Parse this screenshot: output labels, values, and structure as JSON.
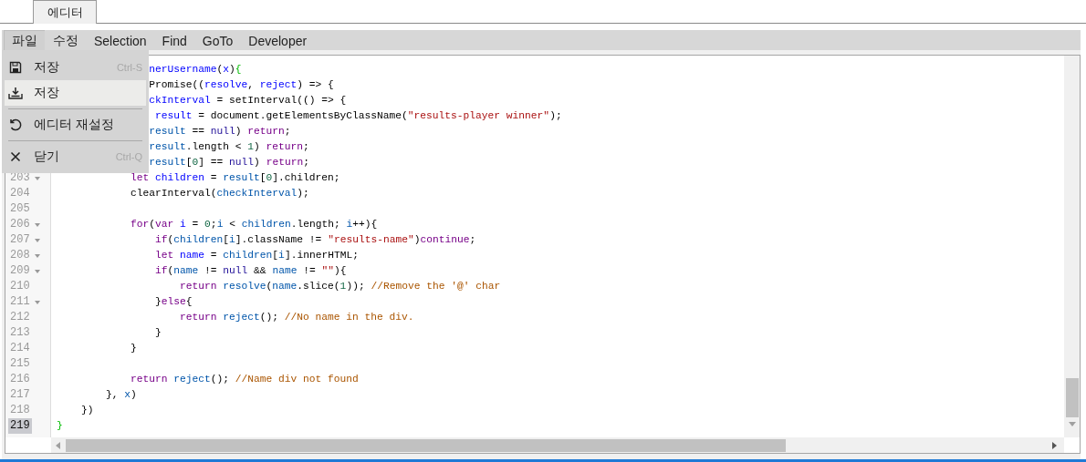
{
  "tabs": [
    {
      "label": "에디터",
      "selected": true
    }
  ],
  "menubar": [
    {
      "label": "파일",
      "selected": true
    },
    {
      "label": "수정",
      "selected": false
    },
    {
      "label": "Selection",
      "selected": false
    },
    {
      "label": "Find",
      "selected": false
    },
    {
      "label": "GoTo",
      "selected": false
    },
    {
      "label": "Developer",
      "selected": false
    }
  ],
  "file_menu": [
    {
      "kind": "save",
      "label": "저장",
      "shortcut": "Ctrl-S",
      "selected": false
    },
    {
      "kind": "download",
      "label": "저장",
      "selected": true
    },
    {
      "kind": "separator"
    },
    {
      "kind": "reset",
      "label": "에디터 재설정",
      "selected": false
    },
    {
      "kind": "separator"
    },
    {
      "kind": "close",
      "label": "닫기",
      "shortcut": "Ctrl-Q",
      "selected": false
    }
  ],
  "code_lines": [
    {
      "tokens": [
        {
          "text": "               nerUsername",
          "kind": "def"
        },
        {
          "text": "(",
          "kind": "plain"
        },
        {
          "text": "x",
          "kind": "def"
        },
        {
          "text": ")",
          "kind": "plain"
        },
        {
          "text": "{",
          "kind": "brace"
        }
      ]
    },
    {
      "tokens": [
        {
          "text": "               Promise((",
          "kind": "plain"
        },
        {
          "text": "resolve",
          "kind": "def"
        },
        {
          "text": ", ",
          "kind": "plain"
        },
        {
          "text": "reject",
          "kind": "def"
        },
        {
          "text": ") => {",
          "kind": "plain"
        }
      ]
    },
    {
      "tokens": [
        {
          "text": "               ckInterval",
          "kind": "def"
        },
        {
          "text": " = setInterval(() => {",
          "kind": "plain"
        }
      ]
    },
    {
      "tokens": [
        {
          "text": "                result",
          "kind": "def"
        },
        {
          "text": " = document.getElementsByClassName(",
          "kind": "plain"
        },
        {
          "text": "\"results-player winner\"",
          "kind": "str"
        },
        {
          "text": ");",
          "kind": "plain"
        }
      ]
    },
    {
      "tokens": [
        {
          "text": "               result",
          "kind": "var"
        },
        {
          "text": " == ",
          "kind": "plain"
        },
        {
          "text": "null",
          "kind": "atom"
        },
        {
          "text": ") ",
          "kind": "plain"
        },
        {
          "text": "return",
          "kind": "kw"
        },
        {
          "text": ";",
          "kind": "plain"
        }
      ]
    },
    {
      "tokens": [
        {
          "text": "               result",
          "kind": "var"
        },
        {
          "text": ".length < ",
          "kind": "plain"
        },
        {
          "text": "1",
          "kind": "num"
        },
        {
          "text": ") ",
          "kind": "plain"
        },
        {
          "text": "return",
          "kind": "kw"
        },
        {
          "text": ";",
          "kind": "plain"
        }
      ]
    },
    {
      "tokens": [
        {
          "text": "               result",
          "kind": "var"
        },
        {
          "text": "[",
          "kind": "plain"
        },
        {
          "text": "0",
          "kind": "num"
        },
        {
          "text": "] == ",
          "kind": "plain"
        },
        {
          "text": "null",
          "kind": "atom"
        },
        {
          "text": ") ",
          "kind": "plain"
        },
        {
          "text": "return",
          "kind": "kw"
        },
        {
          "text": ";",
          "kind": "plain"
        }
      ]
    },
    {
      "number": "203",
      "foldable": true,
      "active": false,
      "tokens": [
        {
          "text": "            let",
          "kind": "kw"
        },
        {
          "text": " children",
          "kind": "def"
        },
        {
          "text": " = ",
          "kind": "plain"
        },
        {
          "text": "result",
          "kind": "var"
        },
        {
          "text": "[",
          "kind": "plain"
        },
        {
          "text": "0",
          "kind": "num"
        },
        {
          "text": "].children;",
          "kind": "plain"
        }
      ]
    },
    {
      "number": "204",
      "foldable": false,
      "active": false,
      "tokens": [
        {
          "text": "            clearInterval(",
          "kind": "plain"
        },
        {
          "text": "checkInterval",
          "kind": "var"
        },
        {
          "text": ");",
          "kind": "plain"
        }
      ]
    },
    {
      "number": "205",
      "foldable": false,
      "active": false
    },
    {
      "number": "206",
      "foldable": true,
      "active": false,
      "tokens": [
        {
          "text": "            for",
          "kind": "kw"
        },
        {
          "text": "(",
          "kind": "plain"
        },
        {
          "text": "var",
          "kind": "kw"
        },
        {
          "text": " i",
          "kind": "def"
        },
        {
          "text": " = ",
          "kind": "plain"
        },
        {
          "text": "0",
          "kind": "num"
        },
        {
          "text": ";",
          "kind": "plain"
        },
        {
          "text": "i",
          "kind": "var"
        },
        {
          "text": " < ",
          "kind": "plain"
        },
        {
          "text": "children",
          "kind": "var"
        },
        {
          "text": ".length; ",
          "kind": "plain"
        },
        {
          "text": "i",
          "kind": "var"
        },
        {
          "text": "++){",
          "kind": "plain"
        }
      ]
    },
    {
      "number": "207",
      "foldable": true,
      "active": false,
      "tokens": [
        {
          "text": "                if",
          "kind": "kw"
        },
        {
          "text": "(",
          "kind": "plain"
        },
        {
          "text": "children",
          "kind": "var"
        },
        {
          "text": "[",
          "kind": "plain"
        },
        {
          "text": "i",
          "kind": "var"
        },
        {
          "text": "].className != ",
          "kind": "plain"
        },
        {
          "text": "\"results-name\"",
          "kind": "str"
        },
        {
          "text": ")",
          "kind": "plain"
        },
        {
          "text": "continue",
          "kind": "kw"
        },
        {
          "text": ";",
          "kind": "plain"
        }
      ]
    },
    {
      "number": "208",
      "foldable": true,
      "active": false,
      "tokens": [
        {
          "text": "                let",
          "kind": "kw"
        },
        {
          "text": " name",
          "kind": "def"
        },
        {
          "text": " = ",
          "kind": "plain"
        },
        {
          "text": "children",
          "kind": "var"
        },
        {
          "text": "[",
          "kind": "plain"
        },
        {
          "text": "i",
          "kind": "var"
        },
        {
          "text": "].innerHTML;",
          "kind": "plain"
        }
      ]
    },
    {
      "number": "209",
      "foldable": true,
      "active": false,
      "tokens": [
        {
          "text": "                if",
          "kind": "kw"
        },
        {
          "text": "(",
          "kind": "plain"
        },
        {
          "text": "name",
          "kind": "var"
        },
        {
          "text": " != ",
          "kind": "plain"
        },
        {
          "text": "null",
          "kind": "atom"
        },
        {
          "text": " && ",
          "kind": "plain"
        },
        {
          "text": "name",
          "kind": "var"
        },
        {
          "text": " != ",
          "kind": "plain"
        },
        {
          "text": "\"\"",
          "kind": "str"
        },
        {
          "text": "){",
          "kind": "plain"
        }
      ]
    },
    {
      "number": "210",
      "foldable": false,
      "active": false,
      "tokens": [
        {
          "text": "                    return",
          "kind": "kw"
        },
        {
          "text": " resolve",
          "kind": "var"
        },
        {
          "text": "(",
          "kind": "plain"
        },
        {
          "text": "name",
          "kind": "var"
        },
        {
          "text": ".slice(",
          "kind": "plain"
        },
        {
          "text": "1",
          "kind": "num"
        },
        {
          "text": ")); ",
          "kind": "plain"
        },
        {
          "text": "//Remove the '@' char",
          "kind": "com"
        }
      ]
    },
    {
      "number": "211",
      "foldable": true,
      "active": false,
      "tokens": [
        {
          "text": "                }",
          "kind": "plain"
        },
        {
          "text": "else",
          "kind": "kw"
        },
        {
          "text": "{",
          "kind": "plain"
        }
      ]
    },
    {
      "number": "212",
      "foldable": false,
      "active": false,
      "tokens": [
        {
          "text": "                    return",
          "kind": "kw"
        },
        {
          "text": " reject",
          "kind": "var"
        },
        {
          "text": "(); ",
          "kind": "plain"
        },
        {
          "text": "//No name in the div.",
          "kind": "com"
        }
      ]
    },
    {
      "number": "213",
      "foldable": false,
      "active": false,
      "tokens": [
        {
          "text": "                }",
          "kind": "plain"
        }
      ]
    },
    {
      "number": "214",
      "foldable": false,
      "active": false,
      "tokens": [
        {
          "text": "            }",
          "kind": "plain"
        }
      ]
    },
    {
      "number": "215",
      "foldable": false,
      "active": false
    },
    {
      "number": "216",
      "foldable": false,
      "active": false,
      "tokens": [
        {
          "text": "            return",
          "kind": "kw"
        },
        {
          "text": " reject",
          "kind": "var"
        },
        {
          "text": "(); ",
          "kind": "plain"
        },
        {
          "text": "//Name div not found",
          "kind": "com"
        }
      ]
    },
    {
      "number": "217",
      "foldable": false,
      "active": false,
      "tokens": [
        {
          "text": "        }, ",
          "kind": "plain"
        },
        {
          "text": "x",
          "kind": "var"
        },
        {
          "text": ")",
          "kind": "plain"
        }
      ]
    },
    {
      "number": "218",
      "foldable": false,
      "active": false,
      "tokens": [
        {
          "text": "    })",
          "kind": "plain"
        }
      ]
    },
    {
      "number": "219",
      "foldable": false,
      "active": true,
      "tokens": [
        {
          "text": "}",
          "kind": "brace"
        }
      ]
    }
  ]
}
